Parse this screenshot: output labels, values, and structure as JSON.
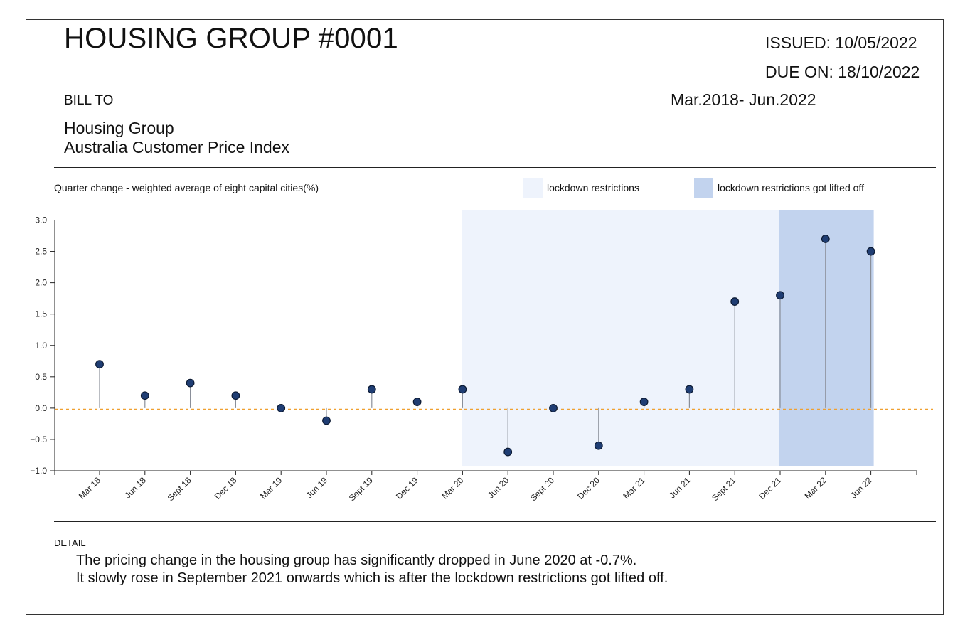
{
  "header": {
    "title": "HOUSING GROUP #0001",
    "issued": "ISSUED: 10/05/2022",
    "due": "DUE ON: 18/10/2022",
    "bill_to_label": "BILL TO",
    "period": "Mar.2018- Jun.2022",
    "bill_to_name": "Housing Group",
    "bill_to_sub": "Australia Customer Price Index"
  },
  "detail": {
    "label": "DETAIL",
    "line1": "The pricing change in the housing group has significantly dropped in June 2020 at -0.7%.",
    "line2": "It slowly rose in September 2021 onwards which is after the lockdown restrictions got lifted off."
  },
  "colors": {
    "point": "#1f3d73",
    "stem": "#8a8f99",
    "zero_line": "#f0a030",
    "lockdown": "#eef3fc",
    "lifted": "#c2d3ee"
  },
  "chart_data": {
    "type": "lollipop",
    "ylabel": "Quarter change - weighted average of eight capital cities(%)",
    "ylim": [
      -1.0,
      3.0
    ],
    "yticks": [
      "3.0",
      "2.5",
      "2.0",
      "1.5",
      "1.0",
      "0.5",
      "0.0",
      "−0.5",
      "−1.0"
    ],
    "categories": [
      "Mar 18",
      "Jun 18",
      "Sept 18",
      "Dec 18",
      "Mar 19",
      "Jun 19",
      "Sept 19",
      "Dec 19",
      "Mar 20",
      "Jun 20",
      "Sept 20",
      "Dec 20",
      "Mar 21",
      "Jun 21",
      "Sept 21",
      "Dec 21",
      "Mar 22",
      "Jun 22"
    ],
    "values": [
      0.7,
      0.2,
      0.4,
      0.2,
      0.0,
      -0.2,
      0.3,
      0.1,
      0.3,
      -0.7,
      0.0,
      -0.6,
      0.1,
      0.3,
      1.7,
      1.8,
      2.7,
      2.5
    ],
    "reference_line": 0.0,
    "regions": [
      {
        "label": "lockdown restrictions",
        "from": "Mar 20",
        "to": "Dec 21"
      },
      {
        "label": "lockdown restrictions got lifted off",
        "from": "Dec 21",
        "to": "Jun 22"
      }
    ]
  }
}
